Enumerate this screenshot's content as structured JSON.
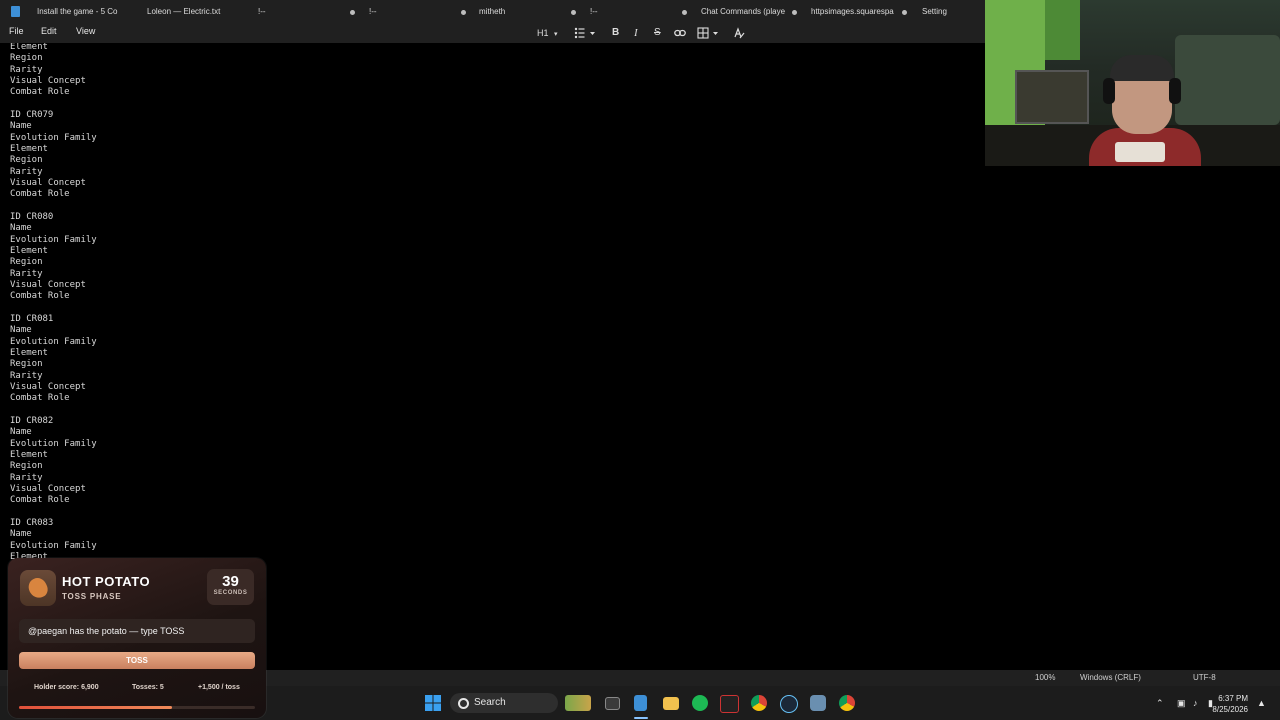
{
  "tabs": [
    {
      "label": "Install the game - 5 Co"
    },
    {
      "label": "Loleon — Electric.txt"
    },
    {
      "label": "!--"
    },
    {
      "label": "!--"
    },
    {
      "label": "mitheth"
    },
    {
      "label": "!--"
    },
    {
      "label": "Chat Commands (playe"
    },
    {
      "label": "httpsimages.squarespa"
    },
    {
      "label": "Setting"
    }
  ],
  "menu": {
    "file": "File",
    "edit": "Edit",
    "view": "View"
  },
  "toolbar": {
    "heading": "H1"
  },
  "editor_lines": [
    "Element",
    "Region",
    "Rarity",
    "Visual Concept",
    "Combat Role",
    "",
    "ID CR079",
    "Name",
    "Evolution Family",
    "Element",
    "Region",
    "Rarity",
    "Visual Concept",
    "Combat Role",
    "",
    "ID CR080",
    "Name",
    "Evolution Family",
    "Element",
    "Region",
    "Rarity",
    "Visual Concept",
    "Combat Role",
    "",
    "ID CR081",
    "Name",
    "Evolution Family",
    "Element",
    "Region",
    "Rarity",
    "Visual Concept",
    "Combat Role",
    "",
    "ID CR082",
    "Name",
    "Evolution Family",
    "Element",
    "Region",
    "Rarity",
    "Visual Concept",
    "Combat Role",
    "",
    "ID CR083",
    "Name",
    "Evolution Family",
    "Element"
  ],
  "status": {
    "zoom": "100%",
    "line_ending": "Windows (CRLF)",
    "encoding": "UTF-8"
  },
  "taskbar": {
    "search_label": "Search",
    "time": "6:37 PM",
    "date": "8/25/2026"
  },
  "hot_potato": {
    "title": "HOT POTATO",
    "phase": "TOSS PHASE",
    "timer_value": "39",
    "timer_unit": "SECONDS",
    "message": "@paegan has the potato — type TOSS",
    "button_label": "TOSS",
    "holder_score": "Holder score: 6,900",
    "tosses": "Tosses: 5",
    "per_toss": "+1,500 / toss",
    "progress": 0.65
  },
  "colors": {
    "accent": "#e8aa86",
    "progress": "#e0503a",
    "app_icon": "#3d8fd6"
  }
}
